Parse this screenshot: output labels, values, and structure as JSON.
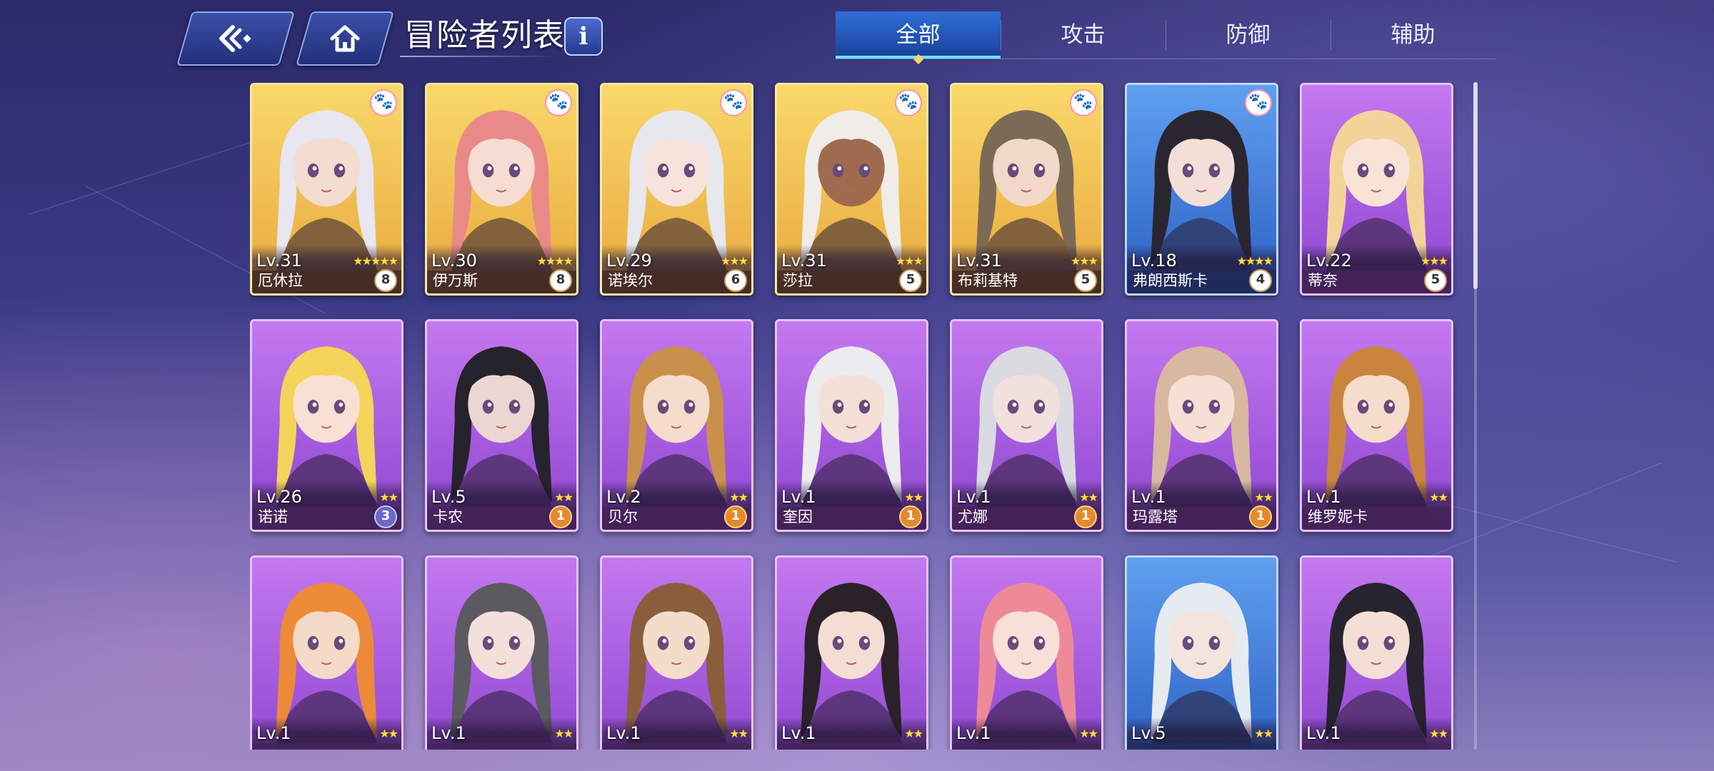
{
  "header": {
    "title": "冒险者列表",
    "info_label": "i"
  },
  "tabs": [
    {
      "label": "全部",
      "active": true
    },
    {
      "label": "攻击",
      "active": false
    },
    {
      "label": "防御",
      "active": false
    },
    {
      "label": "辅助",
      "active": false
    }
  ],
  "cards": [
    {
      "name": "厄休拉",
      "level": "Lv.31",
      "stars": "★★★★★",
      "badge": "8",
      "frame": "gold",
      "paw": true,
      "hair": "#e8e6f0",
      "skin": "#f3dcd0"
    },
    {
      "name": "伊万斯",
      "level": "Lv.30",
      "stars": "★★★★",
      "badge": "8",
      "frame": "gold",
      "paw": true,
      "hair": "#e98a88",
      "skin": "#f7dcd3"
    },
    {
      "name": "诺埃尔",
      "level": "Lv.29",
      "stars": "★★★",
      "badge": "6",
      "frame": "gold",
      "paw": true,
      "hair": "#e6e8ee",
      "skin": "#f5e3dc"
    },
    {
      "name": "莎拉",
      "level": "Lv.31",
      "stars": "★★★",
      "badge": "5",
      "frame": "gold",
      "paw": true,
      "hair": "#f0ece8",
      "skin": "#a06a4e"
    },
    {
      "name": "布莉基特",
      "level": "Lv.31",
      "stars": "★★★",
      "badge": "5",
      "frame": "gold",
      "paw": true,
      "hair": "#7b6a55",
      "skin": "#f2d8c8"
    },
    {
      "name": "弗朗西斯卡",
      "level": "Lv.18",
      "stars": "★★★★",
      "badge": "4",
      "frame": "blue",
      "paw": true,
      "hair": "#2a2630",
      "skin": "#f3dfd8"
    },
    {
      "name": "蒂奈",
      "level": "Lv.22",
      "stars": "★★★",
      "badge": "5",
      "frame": "purple",
      "paw": false,
      "hair": "#f2d49a",
      "skin": "#f8e3d6"
    },
    {
      "name": "诺诺",
      "level": "Lv.26",
      "stars": "★★",
      "badge": "3",
      "frame": "purple",
      "paw": false,
      "hair": "#f4d45a",
      "skin": "#f8e0d4"
    },
    {
      "name": "卡农",
      "level": "Lv.5",
      "stars": "★★",
      "badge": "1",
      "frame": "purple",
      "paw": false,
      "hair": "#25232c",
      "skin": "#ecd6d2"
    },
    {
      "name": "贝尔",
      "level": "Lv.2",
      "stars": "★★",
      "badge": "1",
      "frame": "purple",
      "paw": false,
      "hair": "#c9904c",
      "skin": "#f6dccc"
    },
    {
      "name": "奎因",
      "level": "Lv.1",
      "stars": "★★",
      "badge": "1",
      "frame": "purple",
      "paw": false,
      "hair": "#ecebee",
      "skin": "#f5e0d8"
    },
    {
      "name": "尤娜",
      "level": "Lv.1",
      "stars": "★★",
      "badge": "1",
      "frame": "purple",
      "paw": false,
      "hair": "#d9dbe0",
      "skin": "#f2e0dc"
    },
    {
      "name": "玛露塔",
      "level": "Lv.1",
      "stars": "★★",
      "badge": "1",
      "frame": "purple",
      "paw": false,
      "hair": "#d8b8a0",
      "skin": "#f6dfd4"
    },
    {
      "name": "维罗妮卡",
      "level": "Lv.1",
      "stars": "★★",
      "badge": "",
      "frame": "purple",
      "paw": false,
      "hair": "#c9843e",
      "skin": "#f6dccb"
    },
    {
      "name": "",
      "level": "Lv.1",
      "stars": "★★",
      "badge": "",
      "frame": "purple",
      "paw": false,
      "hair": "#ec8a38",
      "skin": "#f6dac8"
    },
    {
      "name": "",
      "level": "Lv.1",
      "stars": "★★",
      "badge": "",
      "frame": "purple",
      "paw": false,
      "hair": "#5a5a60",
      "skin": "#f4e0da"
    },
    {
      "name": "",
      "level": "Lv.1",
      "stars": "★★",
      "badge": "",
      "frame": "purple",
      "paw": false,
      "hair": "#8a5e3c",
      "skin": "#f4dccb"
    },
    {
      "name": "",
      "level": "Lv.1",
      "stars": "★★",
      "badge": "",
      "frame": "purple",
      "paw": false,
      "hair": "#2a2228",
      "skin": "#f4ddd2"
    },
    {
      "name": "",
      "level": "Lv.1",
      "stars": "★★",
      "badge": "",
      "frame": "purple",
      "paw": false,
      "hair": "#ee8a98",
      "skin": "#f8e0d8"
    },
    {
      "name": "",
      "level": "Lv.5",
      "stars": "★★",
      "badge": "",
      "frame": "blue",
      "paw": false,
      "hair": "#e6ebf2",
      "skin": "#f4e4de"
    },
    {
      "name": "",
      "level": "Lv.1",
      "stars": "★★",
      "badge": "",
      "frame": "purple",
      "paw": false,
      "hair": "#26242e",
      "skin": "#f4ded6"
    }
  ]
}
